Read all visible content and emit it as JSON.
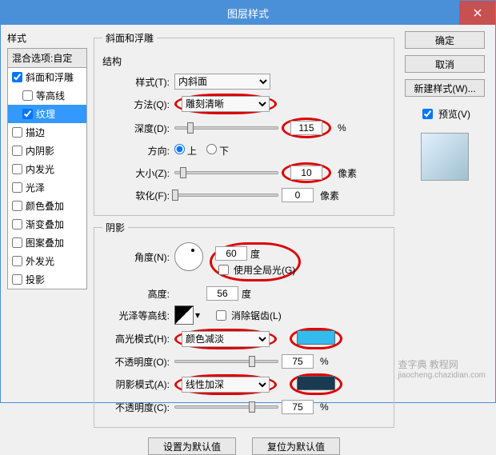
{
  "window": {
    "title": "图层样式"
  },
  "left": {
    "group_label": "样式",
    "blend_header": "混合选项:自定",
    "items": [
      {
        "label": "斜面和浮雕",
        "checked": true,
        "selected": false,
        "indent": false
      },
      {
        "label": "等高线",
        "checked": false,
        "selected": false,
        "indent": true
      },
      {
        "label": "纹理",
        "checked": true,
        "selected": true,
        "indent": true
      },
      {
        "label": "描边",
        "checked": false,
        "selected": false,
        "indent": false
      },
      {
        "label": "内阴影",
        "checked": false,
        "selected": false,
        "indent": false
      },
      {
        "label": "内发光",
        "checked": false,
        "selected": false,
        "indent": false
      },
      {
        "label": "光泽",
        "checked": false,
        "selected": false,
        "indent": false
      },
      {
        "label": "颜色叠加",
        "checked": false,
        "selected": false,
        "indent": false
      },
      {
        "label": "渐变叠加",
        "checked": false,
        "selected": false,
        "indent": false
      },
      {
        "label": "图案叠加",
        "checked": false,
        "selected": false,
        "indent": false
      },
      {
        "label": "外发光",
        "checked": false,
        "selected": false,
        "indent": false
      },
      {
        "label": "投影",
        "checked": false,
        "selected": false,
        "indent": false
      }
    ]
  },
  "bevel": {
    "group_title": "斜面和浮雕",
    "structure_label": "结构",
    "style_label": "样式(T):",
    "style_value": "内斜面",
    "technique_label": "方法(Q):",
    "technique_value": "雕刻清晰",
    "depth_label": "深度(D):",
    "depth_value": "115",
    "depth_unit": "%",
    "direction_label": "方向:",
    "direction_up": "上",
    "direction_down": "下",
    "size_label": "大小(Z):",
    "size_value": "10",
    "size_unit": "像素",
    "soften_label": "软化(F):",
    "soften_value": "0",
    "soften_unit": "像素"
  },
  "shading": {
    "group_label": "阴影",
    "angle_label": "角度(N):",
    "angle_value": "60",
    "angle_unit": "度",
    "global_light": "使用全局光(G)",
    "altitude_label": "高度:",
    "altitude_value": "56",
    "altitude_unit": "度",
    "gloss_label": "光泽等高线:",
    "antialias": "消除锯齿(L)",
    "highlight_mode_label": "高光模式(H):",
    "highlight_mode_value": "颜色减淡",
    "highlight_color": "#33bbee",
    "highlight_opacity_label": "不透明度(O):",
    "highlight_opacity_value": "75",
    "highlight_opacity_unit": "%",
    "shadow_mode_label": "阴影模式(A):",
    "shadow_mode_value": "线性加深",
    "shadow_color": "#1a3a52",
    "shadow_opacity_label": "不透明度(C):",
    "shadow_opacity_value": "75",
    "shadow_opacity_unit": "%"
  },
  "buttons": {
    "ok": "确定",
    "cancel": "取消",
    "new_style": "新建样式(W)...",
    "preview": "预览(V)",
    "make_default": "设置为默认值",
    "reset_default": "复位为默认值"
  },
  "watermark": {
    "main": "查字典 教程网",
    "sub": "jiaocheng.chazidian.com"
  }
}
